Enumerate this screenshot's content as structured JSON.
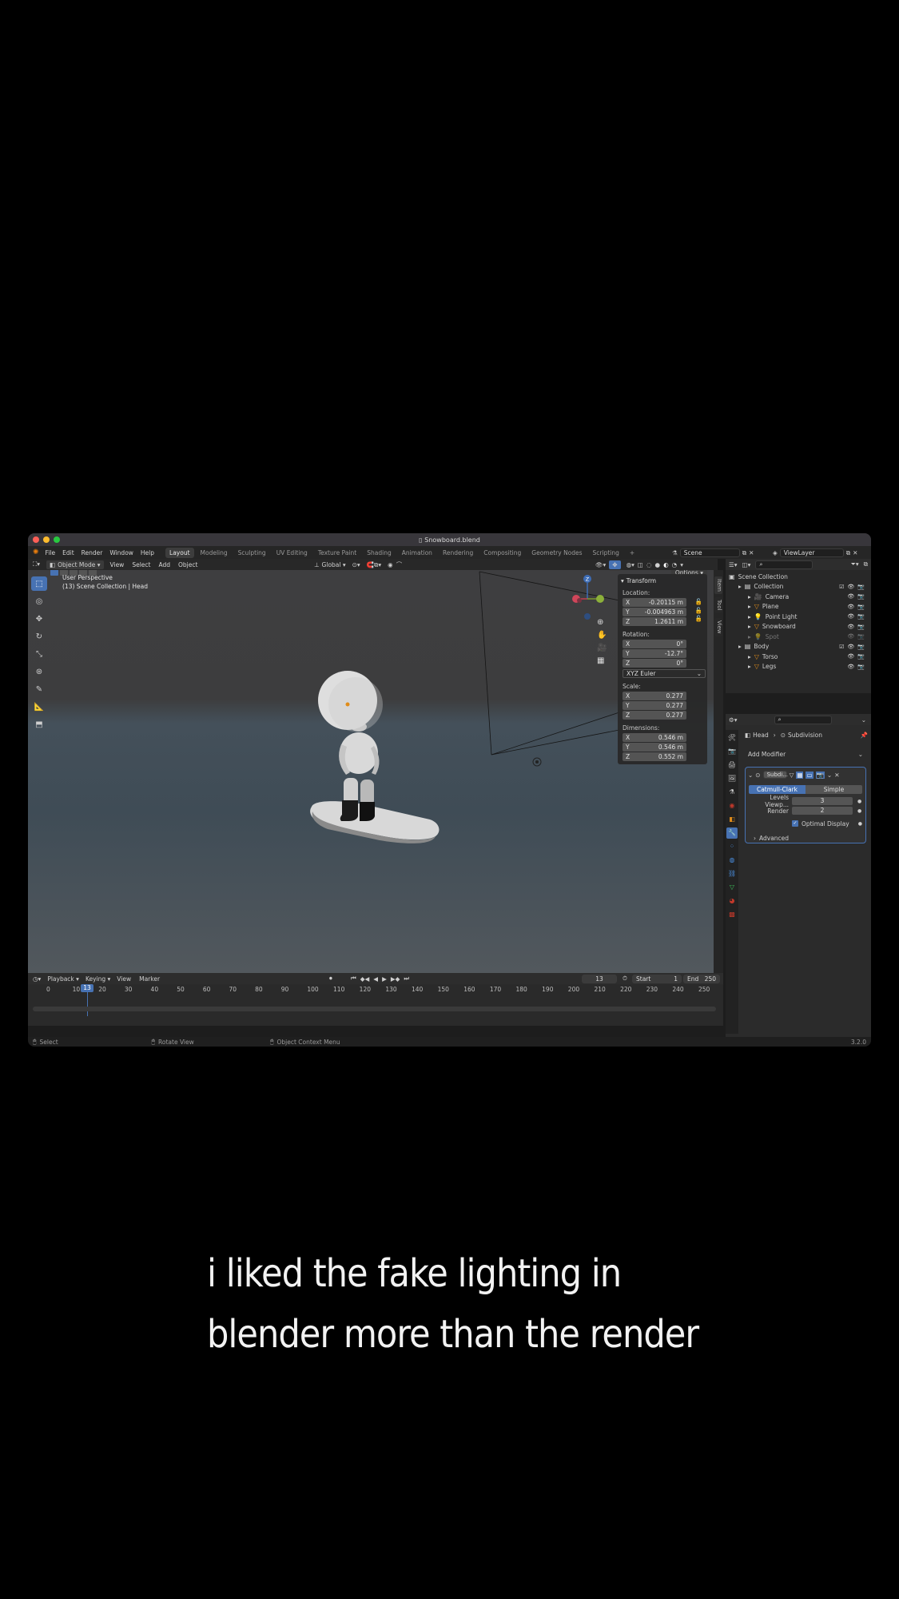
{
  "window": {
    "title": "Snowboard.blend",
    "traffic_colors": [
      "#fe5f57",
      "#febc2e",
      "#28c840"
    ]
  },
  "menubar": {
    "menus": [
      "File",
      "Edit",
      "Render",
      "Window",
      "Help"
    ],
    "workspaces": [
      "Layout",
      "Modeling",
      "Sculpting",
      "UV Editing",
      "Texture Paint",
      "Shading",
      "Animation",
      "Rendering",
      "Compositing",
      "Geometry Nodes",
      "Scripting",
      "+"
    ],
    "active_workspace": "Layout",
    "scene": "Scene",
    "view_layer": "ViewLayer"
  },
  "viewport_header": {
    "mode": "Object Mode",
    "menus": [
      "View",
      "Select",
      "Add",
      "Object"
    ],
    "orientation": "Global",
    "options": "Options"
  },
  "viewport": {
    "perspective": "User Perspective",
    "collection_info": "(13) Scene Collection | Head",
    "gizmo": {
      "x": "X",
      "y": "Y",
      "z": "Z"
    }
  },
  "npanel": {
    "header": "Transform",
    "location_label": "Location:",
    "location": {
      "x": "-0.20115 m",
      "y": "-0.004963 m",
      "z": "1.2611 m"
    },
    "rotation_label": "Rotation:",
    "rotation": {
      "x": "0°",
      "y": "-12.7°",
      "z": "0°"
    },
    "rotation_mode": "XYZ Euler",
    "scale_label": "Scale:",
    "scale": {
      "x": "0.277",
      "y": "0.277",
      "z": "0.277"
    },
    "dimensions_label": "Dimensions:",
    "dimensions": {
      "x": "0.546 m",
      "y": "0.546 m",
      "z": "0.552 m"
    },
    "axis": {
      "x": "X",
      "y": "Y",
      "z": "Z"
    },
    "tabs": [
      "Item",
      "Tool",
      "View"
    ]
  },
  "outliner": {
    "root": "Scene Collection",
    "items": [
      {
        "label": "Collection",
        "icon": "collection-icon",
        "level": 1
      },
      {
        "label": "Camera",
        "icon": "camera-icon",
        "level": 2
      },
      {
        "label": "Plane",
        "icon": "mesh-icon",
        "level": 2
      },
      {
        "label": "Point Light",
        "icon": "light-icon",
        "level": 2
      },
      {
        "label": "Snowboard",
        "icon": "mesh-icon",
        "level": 2
      },
      {
        "label": "Spot",
        "icon": "light-icon",
        "level": 2,
        "dim": true
      },
      {
        "label": "Body",
        "icon": "collection-icon",
        "level": 1
      },
      {
        "label": "Torso",
        "icon": "mesh-icon",
        "level": 2
      },
      {
        "label": "Legs",
        "icon": "mesh-icon",
        "level": 2
      }
    ]
  },
  "properties": {
    "breadcrumb_object": "Head",
    "breadcrumb_modifier": "Subdivision",
    "add_modifier": "Add Modifier",
    "modifier_name": "Subdi...",
    "type_options": [
      "Catmull-Clark",
      "Simple"
    ],
    "active_type": "Catmull-Clark",
    "levels_viewport_label": "Levels Viewp...",
    "levels_viewport": "3",
    "render_label": "Render",
    "render": "2",
    "optimal_display": "Optimal Display",
    "advanced": "Advanced"
  },
  "timeline": {
    "menus": [
      "Playback",
      "Keying",
      "View",
      "Marker"
    ],
    "current_frame": "13",
    "start_label": "Start",
    "start": "1",
    "end_label": "End",
    "end": "250",
    "ruler": [
      "0",
      "10",
      "20",
      "30",
      "40",
      "50",
      "60",
      "70",
      "80",
      "90",
      "100",
      "110",
      "120",
      "130",
      "140",
      "150",
      "160",
      "170",
      "180",
      "190",
      "200",
      "210",
      "220",
      "230",
      "240",
      "250"
    ]
  },
  "statusbar": {
    "select": "Select",
    "rotate": "Rotate View",
    "context": "Object Context Menu",
    "version": "3.2.0"
  },
  "caption": {
    "line1": "i liked the fake lighting in",
    "line2": "blender more than the render"
  }
}
